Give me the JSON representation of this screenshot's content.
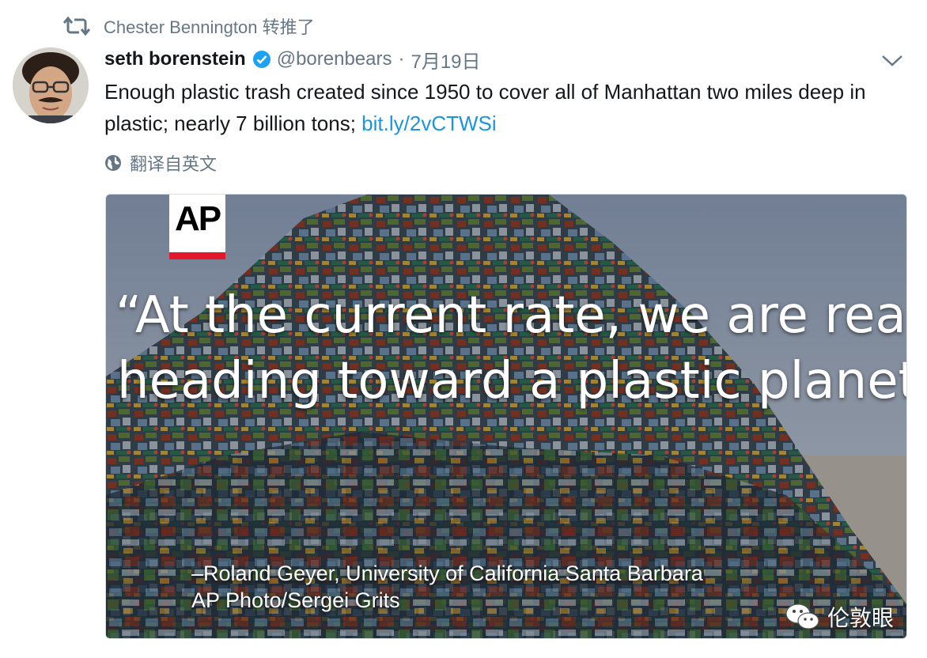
{
  "retweet": {
    "icon": "retweet-icon",
    "text": "Chester Bennington 转推了"
  },
  "author": {
    "name": "seth borenstein",
    "verified_icon": "verified-badge-icon",
    "handle": "@borenbears",
    "separator": "·",
    "date": "7月19日",
    "avatar_icon": "avatar"
  },
  "menu": {
    "icon": "chevron-down-icon"
  },
  "tweet": {
    "text": "Enough plastic trash created since 1950 to cover all of Manhattan two miles deep in plastic; nearly 7 billion tons; ",
    "link": "bit.ly/2vCTWSi"
  },
  "translate": {
    "icon": "globe-icon",
    "label": "翻译自英文"
  },
  "media": {
    "logo_text": "AP",
    "quote_line1": "“At the current rate, we are really",
    "quote_line2": "heading toward a plastic planet.”",
    "credit_line1": "–Roland Geyer, University of California Santa Barbara",
    "credit_line2": "AP Photo/Sergei Grits"
  },
  "watermark": {
    "icon": "wechat-icon",
    "text": "伦敦眼"
  },
  "colors": {
    "link": "#1b95e0",
    "secondary_text": "#657786",
    "verified": "#1da1f2",
    "ap_red": "#e3192b"
  }
}
